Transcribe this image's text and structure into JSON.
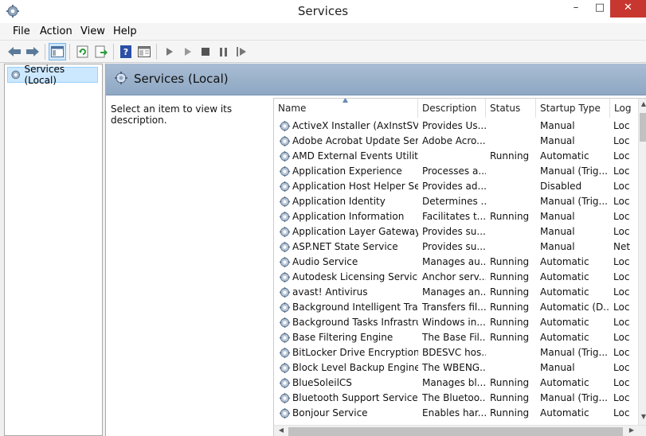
{
  "window": {
    "title": "Services",
    "minimize_glyph": "–",
    "maximize_glyph": "□",
    "close_glyph": "✕"
  },
  "menu": [
    "File",
    "Action",
    "View",
    "Help"
  ],
  "toolbar": {
    "icons": [
      "back-arrow-icon",
      "forward-arrow-icon",
      "show-hide-console-tree-icon",
      "refresh-icon",
      "export-list-icon",
      "help-icon",
      "properties-icon",
      "start-service-icon",
      "start-service-alt-icon",
      "stop-service-icon",
      "pause-service-icon",
      "restart-service-icon"
    ]
  },
  "tree": {
    "selected_label": "Services (Local)"
  },
  "content": {
    "header_title": "Services (Local)",
    "description_prompt": "Select an item to view its description."
  },
  "list": {
    "columns": {
      "name": "Name",
      "description": "Description",
      "status": "Status",
      "startup": "Startup Type",
      "logon": "Log"
    },
    "rows": [
      {
        "name": "ActiveX Installer (AxInstSV)",
        "description": "Provides Us...",
        "status": "",
        "startup": "Manual",
        "logon": "Loc"
      },
      {
        "name": "Adobe Acrobat Update Serv...",
        "description": "Adobe Acro...",
        "status": "",
        "startup": "Manual",
        "logon": "Loc"
      },
      {
        "name": "AMD External Events Utility",
        "description": "",
        "status": "Running",
        "startup": "Automatic",
        "logon": "Loc"
      },
      {
        "name": "Application Experience",
        "description": "Processes a...",
        "status": "",
        "startup": "Manual (Trig...",
        "logon": "Loc"
      },
      {
        "name": "Application Host Helper Ser...",
        "description": "Provides ad...",
        "status": "",
        "startup": "Disabled",
        "logon": "Loc"
      },
      {
        "name": "Application Identity",
        "description": "Determines ...",
        "status": "",
        "startup": "Manual (Trig...",
        "logon": "Loc"
      },
      {
        "name": "Application Information",
        "description": "Facilitates t...",
        "status": "Running",
        "startup": "Manual",
        "logon": "Loc"
      },
      {
        "name": "Application Layer Gateway ...",
        "description": "Provides su...",
        "status": "",
        "startup": "Manual",
        "logon": "Loc"
      },
      {
        "name": "ASP.NET State Service",
        "description": "Provides su...",
        "status": "",
        "startup": "Manual",
        "logon": "Net"
      },
      {
        "name": "Audio Service",
        "description": "Manages au...",
        "status": "Running",
        "startup": "Automatic",
        "logon": "Loc"
      },
      {
        "name": "Autodesk Licensing Service",
        "description": "Anchor serv...",
        "status": "Running",
        "startup": "Automatic",
        "logon": "Loc"
      },
      {
        "name": "avast! Antivirus",
        "description": "Manages an...",
        "status": "Running",
        "startup": "Automatic",
        "logon": "Loc"
      },
      {
        "name": "Background Intelligent Tran...",
        "description": "Transfers fil...",
        "status": "Running",
        "startup": "Automatic (D...",
        "logon": "Loc"
      },
      {
        "name": "Background Tasks Infrastru...",
        "description": "Windows in...",
        "status": "Running",
        "startup": "Automatic",
        "logon": "Loc"
      },
      {
        "name": "Base Filtering Engine",
        "description": "The Base Fil...",
        "status": "Running",
        "startup": "Automatic",
        "logon": "Loc"
      },
      {
        "name": "BitLocker Drive Encryption ...",
        "description": "BDESVC hos...",
        "status": "",
        "startup": "Manual (Trig...",
        "logon": "Loc"
      },
      {
        "name": "Block Level Backup Engine ...",
        "description": "The WBENG...",
        "status": "",
        "startup": "Manual",
        "logon": "Loc"
      },
      {
        "name": "BlueSoleilCS",
        "description": "Manages bl...",
        "status": "Running",
        "startup": "Automatic",
        "logon": "Loc"
      },
      {
        "name": "Bluetooth Support Service",
        "description": "The Bluetoo...",
        "status": "Running",
        "startup": "Manual (Trig...",
        "logon": "Loc"
      },
      {
        "name": "Bonjour Service",
        "description": "Enables har...",
        "status": "Running",
        "startup": "Automatic",
        "logon": "Loc"
      }
    ]
  }
}
